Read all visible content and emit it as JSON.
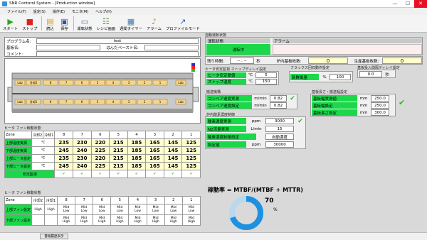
{
  "window": {
    "title": "SNR Contorol System - [Production window]",
    "minimize": "—",
    "maximize": "☐",
    "close": "✕"
  },
  "menu": [
    "ファイル(F)",
    "設定(S)",
    "操作(E)",
    "モニタ(M)",
    "ヘルプ(H)"
  ],
  "toolbar": [
    {
      "label": "スタート",
      "icon": "play-icon",
      "glyph": "▶",
      "color": "#22aa22"
    },
    {
      "label": "ストップ",
      "icon": "stop-icon",
      "glyph": "■",
      "color": "#dd2222"
    },
    {
      "label": "読込",
      "icon": "folder-open-icon",
      "glyph": "📂",
      "color": "#d8a020"
    },
    {
      "label": "保存",
      "icon": "save-icon",
      "glyph": "💾",
      "color": "#335599"
    },
    {
      "label": "運転状態",
      "icon": "monitor-icon",
      "glyph": "🖥",
      "color": "#336699"
    },
    {
      "label": "レシピ画面",
      "icon": "recipe-icon",
      "glyph": "📋",
      "color": "#558833"
    },
    {
      "label": "週間タイマー",
      "icon": "calendar-icon",
      "glyph": "📅",
      "color": "#4477aa"
    },
    {
      "label": "アラーム",
      "icon": "alarm-icon",
      "glyph": "🔔",
      "color": "#dd8800"
    },
    {
      "label": "プロファイルモード",
      "icon": "profile-icon",
      "glyph": "📈",
      "color": "#3366cc"
    }
  ],
  "program": {
    "program_label": "プログラム名:",
    "program_value": "test",
    "board_label": "基板名:",
    "board_value": "",
    "solder_label": "はんだペースト名:",
    "solder_value": "",
    "comment_label": "コメント:",
    "comment_value": ""
  },
  "machine": {
    "zone_labels_top": [
      "Lab",
      "冷却2",
      "8",
      "7",
      "6",
      "5",
      "4",
      "3",
      "2",
      "1",
      "Lab"
    ],
    "zone_labels_bottom": [
      "Lab",
      "冷却1",
      "8",
      "7",
      "6",
      "5",
      "4",
      "3",
      "2",
      "1",
      "Lab"
    ]
  },
  "status": {
    "section": "自動運転状態",
    "run_label": "運転状態",
    "run_value": "運転中",
    "alarm_label": "アラーム",
    "alarm_value": "",
    "remaining_label": "残り時間:",
    "remaining_value": "-- : --",
    "remaining_unit": "秒",
    "in_oven_label": "炉内基板枚数:",
    "in_oven_value": "0",
    "produced_label": "生産基板枚数:",
    "produced_value": "0"
  },
  "heater_delay": {
    "section": "ヒータ安定監視 ストップディレイ設定",
    "threshold_label": "ヒータ安定閾値",
    "threshold_value": "5",
    "threshold_unit": "℃",
    "stop_temp_label": "ストップ温度",
    "stop_temp_value": "150",
    "stop_temp_unit": "℃"
  },
  "flux": {
    "section": "フラックス回収動作設定",
    "air_label": "新鮮風量",
    "air_unit": "%",
    "air_value": "100"
  },
  "board_insert": {
    "section": "基板投入間隔ディレイ設定",
    "value": "0.0",
    "unit": "秒"
  },
  "conveyor": {
    "section": "搬送機構",
    "actual_label": "コンベア速度実測",
    "actual_unit": "m/min",
    "actual_value": "0.82",
    "set_label": "コンベア速度設定",
    "set_unit": "m/min",
    "set_value": "0.82"
  },
  "width": {
    "section": "基板長さ・搬送幅設定",
    "actual_label": "基板幅実測値",
    "actual_unit": "mm",
    "actual_value": "250.0",
    "set_label": "基板幅設定",
    "set_unit": "mm",
    "set_value": "250.0",
    "length_label": "基板長さ設定",
    "length_unit": "mm",
    "length_value": "300.0"
  },
  "oxygen": {
    "section": "炉内酸素濃度制御",
    "actual_label": "酸素濃度実測",
    "actual_unit": "ppm",
    "actual_value": "3000",
    "n2_label": "N2流量実測",
    "n2_unit": "L/min",
    "n2_value": "15",
    "mode_label": "酸素濃度制御設定",
    "mode_value": "自動濃度",
    "setpoint_label": "設定値",
    "setpoint_unit": "ppm",
    "setpoint_value": "30000"
  },
  "heater_table": {
    "section": "ヒータ ファン稼動状態",
    "headers": [
      "Zone",
      "冷却2",
      "冷却1",
      "8",
      "7",
      "6",
      "5",
      "4",
      "3",
      "2",
      "1"
    ],
    "rows": [
      {
        "label": "上部温度実測",
        "unit": "℃",
        "values": [
          "235",
          "230",
          "220",
          "215",
          "185",
          "165",
          "145",
          "125"
        ]
      },
      {
        "label": "下部温度実測",
        "unit": "℃",
        "values": [
          "245",
          "240",
          "225",
          "215",
          "185",
          "165",
          "145",
          "125"
        ]
      },
      {
        "label": "上部ヒータ設定",
        "unit": "℃",
        "values": [
          "235",
          "230",
          "220",
          "215",
          "185",
          "165",
          "145",
          "125"
        ]
      },
      {
        "label": "下部ヒータ設定",
        "unit": "℃",
        "values": [
          "245",
          "240",
          "225",
          "215",
          "185",
          "165",
          "145",
          "125"
        ]
      }
    ],
    "stable_label": "安定監視"
  },
  "fan_table": {
    "section": "ヒータ ファン稼動状態",
    "headers": [
      "Zone",
      "冷却2",
      "冷却1",
      "8",
      "7",
      "6",
      "5",
      "4",
      "3",
      "2",
      "1"
    ],
    "rows": [
      {
        "label": "上部ファン設定",
        "values": [
          "High",
          "High",
          "Mid\nLow",
          "Mid\nLow",
          "Mid\nLow",
          "Mid\nLow",
          "Mid\nLow",
          "Mid\nLow",
          "Mid\nLow",
          "Mid\nLow"
        ]
      },
      {
        "label": "下部ファン設定",
        "values": [
          "",
          "",
          "Mid\nHigh",
          "Mid\nHigh",
          "Mid\nHigh",
          "Mid\nHigh",
          "Mid\nHigh",
          "Mid\nHigh",
          "Mid\nHigh",
          "Mid\nHigh"
        ]
      }
    ]
  },
  "uptime": {
    "formula": "稼動率 = MTBF/(MTBF + MTTR)",
    "value": "70",
    "unit": "%",
    "fraction": 0.7,
    "ring_color": "#1e90e0"
  },
  "statusbar": {
    "button": "警報履歴表示"
  }
}
